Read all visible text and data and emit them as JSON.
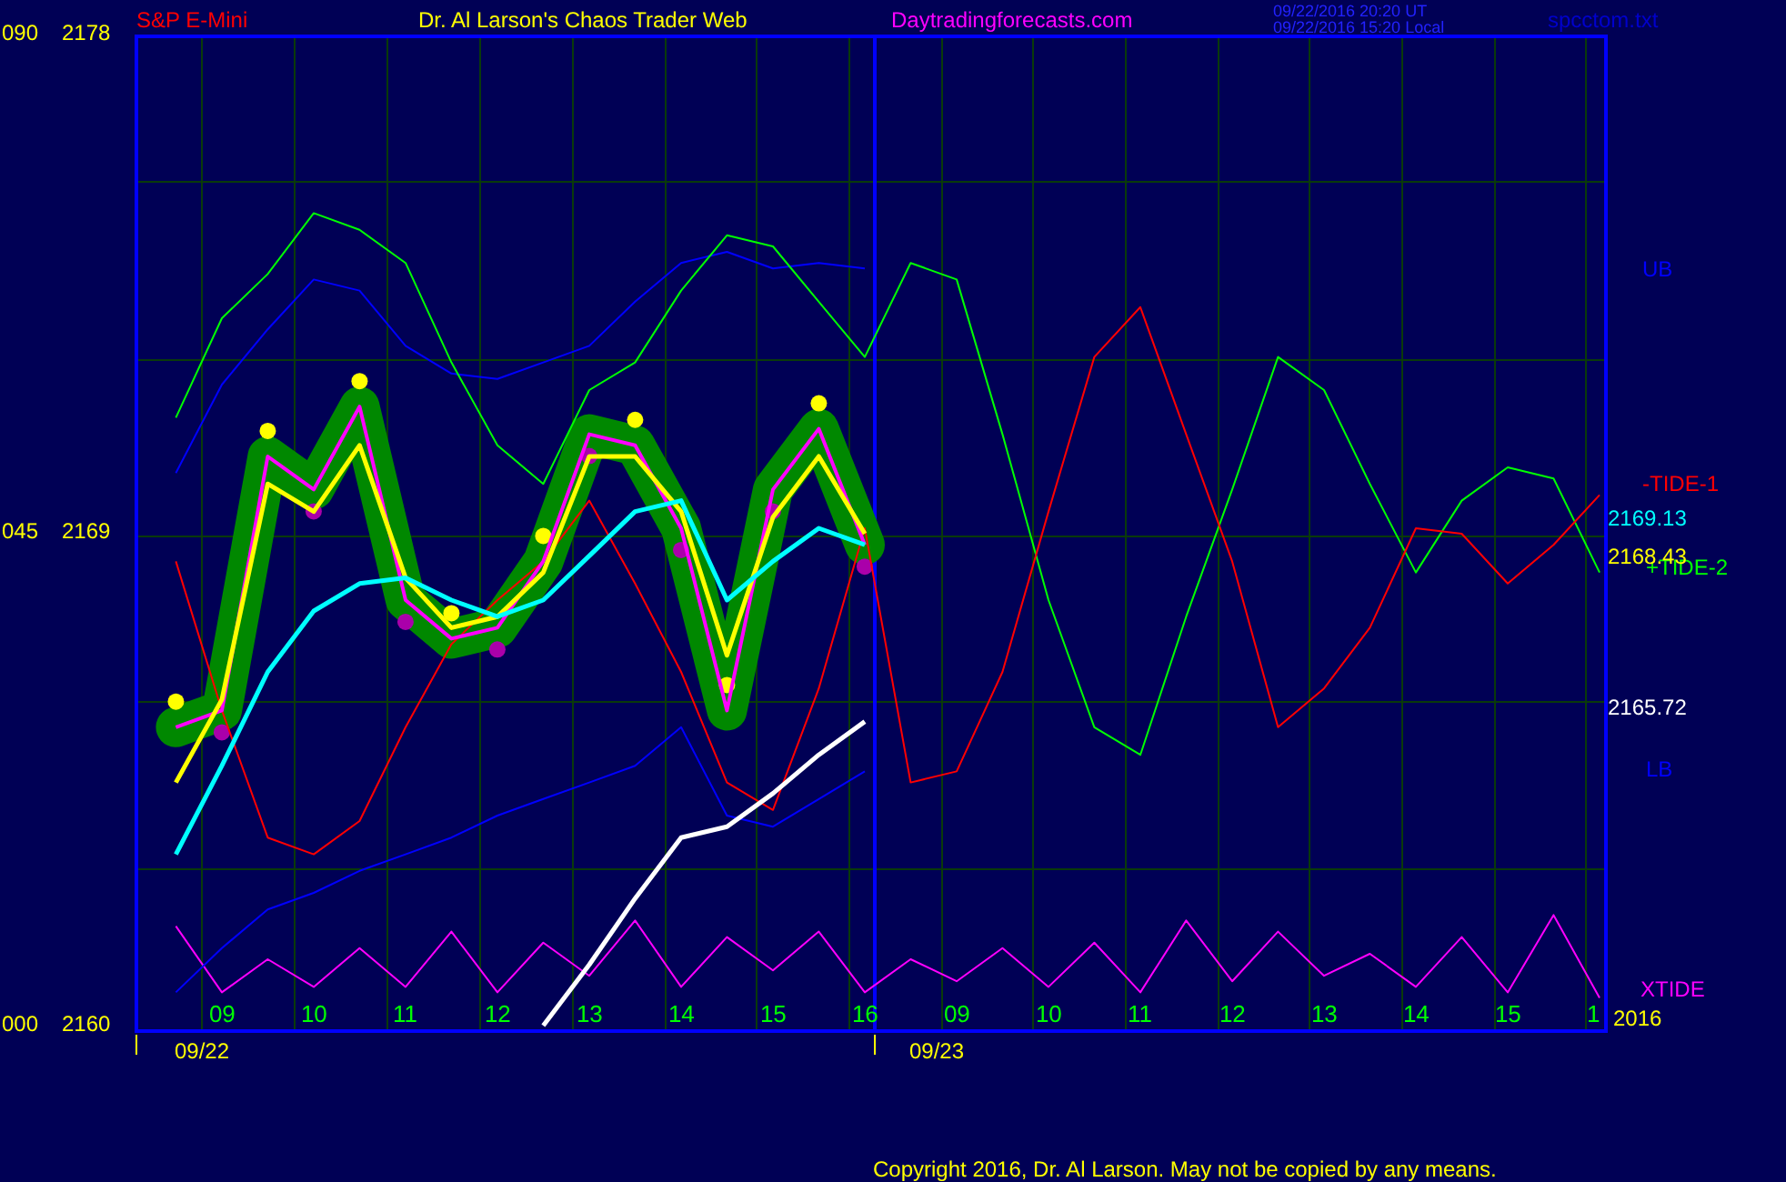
{
  "header": {
    "instrument": "S&P E-Mini",
    "title": "Dr. Al Larson's Chaos Trader Web",
    "site": "Daytradingforecasts.com",
    "time_ut": "09/22/2016 20:20 UT",
    "time_local": "09/22/2016 15:20 Local",
    "file": "spcctom.txt"
  },
  "y_percent": [
    "090",
    "045",
    "000"
  ],
  "readings": [
    {
      "text": "2169.13",
      "color": "#00ffff"
    },
    {
      "text": "2168.43",
      "color": "#ffff00"
    },
    {
      "text": "2165.72",
      "color": "#ffffff"
    }
  ],
  "x_axis": {
    "day2_hours": [
      "09",
      "10",
      "11",
      "12",
      "13",
      "14",
      "15",
      "1"
    ],
    "dates": [
      "09/22",
      "09/23"
    ],
    "year": "2016"
  },
  "chart_data": {
    "type": "line",
    "xlim": [
      8.07,
      24.07
    ],
    "ylim": [
      2160,
      2178
    ],
    "yticks": [
      {
        "value": 2178,
        "label": "2178"
      },
      {
        "value": 2169,
        "label": "2169"
      },
      {
        "value": 2160,
        "label": "2160"
      }
    ],
    "xticks": [
      {
        "value": 9,
        "label": "09"
      },
      {
        "value": 10,
        "label": "10"
      },
      {
        "value": 11,
        "label": "11"
      },
      {
        "value": 12,
        "label": "12"
      },
      {
        "value": 13,
        "label": "13"
      },
      {
        "value": 14,
        "label": "14"
      },
      {
        "value": 15,
        "label": "15"
      },
      {
        "value": 16,
        "label": "16"
      }
    ],
    "x": [
      8.5,
      9,
      9.5,
      10,
      10.5,
      11,
      11.5,
      12,
      12.5,
      13,
      13.5,
      14,
      14.5,
      15,
      15.5,
      16,
      16.5,
      17,
      17.5,
      18,
      18.5,
      19,
      19.5,
      20,
      20.5,
      21,
      21.5,
      22,
      22.5,
      23,
      23.5,
      24
    ],
    "series": [
      {
        "name": "XTIDE",
        "color": "#ff00ff",
        "values": [
          2161.9,
          2160.7,
          2161.3,
          2160.8,
          2161.5,
          2160.8,
          2161.8,
          2160.7,
          2161.6,
          2161.0,
          2162.0,
          2160.8,
          2161.7,
          2161.1,
          2161.8,
          2160.7,
          2161.3,
          2160.9,
          2161.5,
          2160.8,
          2161.6,
          2160.7,
          2162.0,
          2160.9,
          2161.8,
          2161.0,
          2161.4,
          2160.8,
          2161.7,
          2160.7,
          2162.1,
          2160.6
        ]
      },
      {
        "name": "UB",
        "color": "#0000ff",
        "values": [
          2170.1,
          2171.7,
          2172.7,
          2173.6,
          2173.4,
          2172.4,
          2171.9,
          2171.8,
          2172.1,
          2172.4,
          2173.2,
          2173.9,
          2174.1,
          2173.8,
          2173.9,
          2173.8,
          null,
          null,
          null,
          null,
          null,
          null,
          null,
          null,
          null,
          null,
          null,
          null,
          null,
          null,
          null,
          null
        ]
      },
      {
        "name": "LB",
        "color": "#0000ff",
        "values": [
          2160.7,
          2161.5,
          2162.2,
          2162.5,
          2162.9,
          2163.2,
          2163.5,
          2163.9,
          2164.2,
          2164.5,
          2164.8,
          2165.5,
          2163.9,
          2163.7,
          2164.2,
          2164.7,
          null,
          null,
          null,
          null,
          null,
          null,
          null,
          null,
          null,
          null,
          null,
          null,
          null,
          null,
          null,
          null
        ]
      },
      {
        "name": "+TIDE-2",
        "color": "#00ff00",
        "values": [
          2171.1,
          2172.9,
          2173.7,
          2174.8,
          2174.5,
          2173.9,
          2172.1,
          2170.6,
          2169.9,
          2171.6,
          2172.1,
          2173.4,
          2174.4,
          2174.2,
          2173.2,
          2172.2,
          2173.9,
          2173.6,
          2170.8,
          2167.8,
          2165.5,
          2165.0,
          2167.5,
          2169.8,
          2172.2,
          2171.6,
          2169.9,
          2168.3,
          2169.6,
          2170.2,
          2170.0,
          2168.3
        ]
      },
      {
        "name": "-TIDE-1",
        "color": "#ff0000",
        "values": [
          2168.5,
          2165.8,
          2163.5,
          2163.2,
          2163.8,
          2165.5,
          2167.0,
          2167.8,
          2168.5,
          2169.6,
          2168.1,
          2166.5,
          2164.5,
          2164.0,
          2166.2,
          2169.1,
          2164.5,
          2164.7,
          2166.5,
          2169.4,
          2172.2,
          2173.1,
          2170.8,
          2168.5,
          2165.5,
          2166.2,
          2167.3,
          2169.1,
          2169.0,
          2168.1,
          2168.8,
          2169.7
        ]
      },
      {
        "color": "#ff00ff",
        "values": [
          2165.5,
          2165.8,
          2170.4,
          2169.8,
          2171.3,
          2167.8,
          2167.1,
          2167.3,
          2168.5,
          2170.8,
          2170.6,
          2169.1,
          2165.8,
          2169.8,
          2170.9,
          2168.8,
          null,
          null,
          null,
          null,
          null,
          null,
          null,
          null,
          null,
          null,
          null,
          null,
          null,
          null,
          null,
          null
        ]
      },
      {
        "color": "#ffff00",
        "values": [
          2164.5,
          2166.0,
          2169.9,
          2169.4,
          2170.6,
          2168.2,
          2167.3,
          2167.5,
          2168.3,
          2170.4,
          2170.4,
          2169.4,
          2166.8,
          2169.3,
          2170.4,
          2169.0,
          null,
          null,
          null,
          null,
          null,
          null,
          null,
          null,
          null,
          null,
          null,
          null,
          null,
          null,
          null,
          null
        ]
      },
      {
        "color": "#00ffff",
        "values": [
          2163.2,
          2164.8,
          2166.5,
          2167.6,
          2168.1,
          2168.2,
          2167.8,
          2167.5,
          2167.8,
          2168.6,
          2169.4,
          2169.6,
          2167.8,
          2168.5,
          2169.1,
          2168.8,
          null,
          null,
          null,
          null,
          null,
          null,
          null,
          null,
          null,
          null,
          null,
          null,
          null,
          null,
          null,
          null
        ]
      },
      {
        "color": "#ffffff",
        "values": [
          null,
          null,
          null,
          null,
          null,
          null,
          null,
          null,
          2160.1,
          2161.2,
          2162.4,
          2163.5,
          2163.7,
          2164.3,
          2165.0,
          2165.6,
          null,
          null,
          null,
          null,
          null,
          null,
          null,
          null,
          null,
          null,
          null,
          null,
          null,
          null,
          null,
          null
        ]
      }
    ]
  },
  "copyright": "Copyright 2016, Dr. Al Larson. May not be copied by any means."
}
